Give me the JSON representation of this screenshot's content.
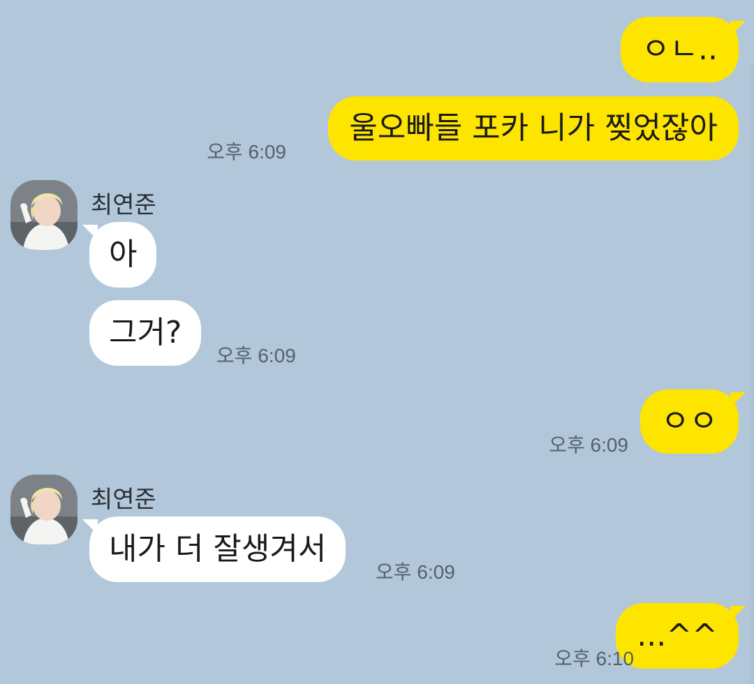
{
  "messages": [
    {
      "from": "me",
      "text": "ㅇㄴ.."
    },
    {
      "from": "me",
      "text": "울오빠들 포카 니가 찢었잖아",
      "time": "오후 6:09"
    },
    {
      "from": "other",
      "sender": "최연준",
      "text": "아"
    },
    {
      "from": "other",
      "text": "그거?",
      "time": "오후 6:09"
    },
    {
      "from": "me",
      "text": "ㅇㅇ",
      "time": "오후 6:09"
    },
    {
      "from": "other",
      "sender": "최연준",
      "text": "내가 더 잘생겨서",
      "time": "오후 6:09"
    },
    {
      "from": "me",
      "text": "...^^",
      "time": "오후 6:10"
    }
  ],
  "avatar_icon": "profile-photo-blond-person",
  "colors": {
    "background": "#b2c7da",
    "my_bubble": "#fee500",
    "their_bubble": "#ffffff",
    "time_text": "#56606a"
  }
}
